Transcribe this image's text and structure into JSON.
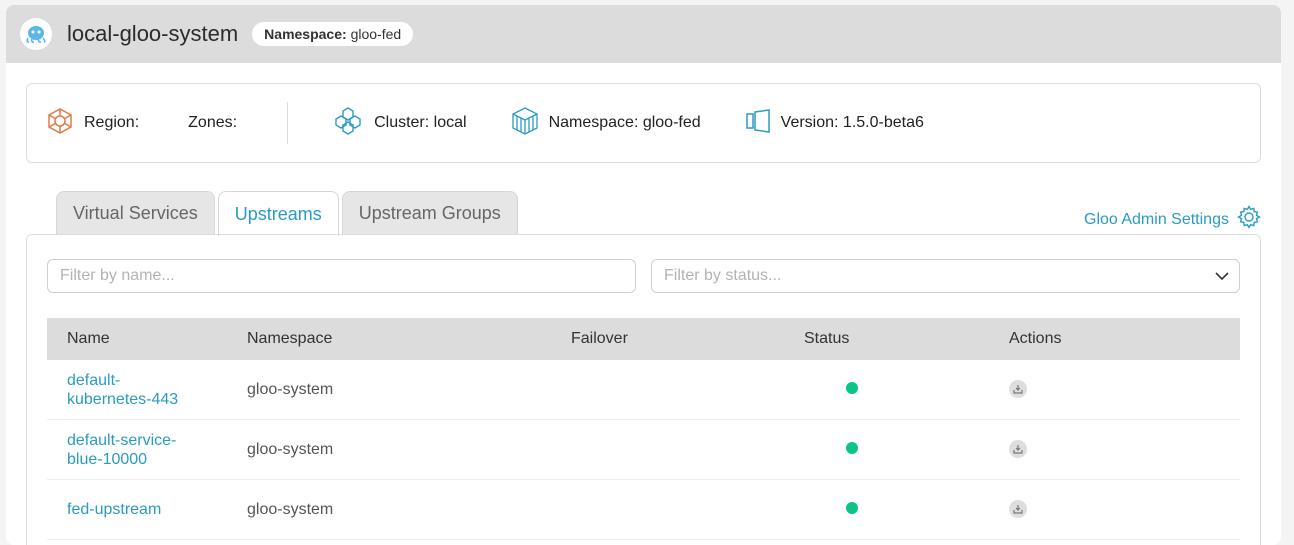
{
  "header": {
    "title": "local-gloo-system",
    "namespace_label": "Namespace:",
    "namespace_value": "gloo-fed"
  },
  "info": {
    "region": "Region:",
    "zones": "Zones:",
    "cluster": "Cluster: local",
    "namespace": "Namespace: gloo-fed",
    "version": "Version: 1.5.0-beta6"
  },
  "tabs": [
    {
      "label": "Virtual Services",
      "active": false
    },
    {
      "label": "Upstreams",
      "active": true
    },
    {
      "label": "Upstream Groups",
      "active": false
    }
  ],
  "settings_link": "Gloo Admin Settings",
  "filters": {
    "name_placeholder": "Filter by name...",
    "status_placeholder": "Filter by status..."
  },
  "table": {
    "columns": [
      "Name",
      "Namespace",
      "Failover",
      "Status",
      "Actions"
    ],
    "rows": [
      {
        "name_line1": "default-",
        "name_line2": "kubernetes-443",
        "namespace": "gloo-system",
        "status": "healthy"
      },
      {
        "name_line1": "default-service-",
        "name_line2": "blue-10000",
        "namespace": "gloo-system",
        "status": "healthy"
      },
      {
        "name_line1": "fed-upstream",
        "name_line2": "",
        "namespace": "gloo-system",
        "status": "healthy"
      }
    ]
  },
  "colors": {
    "accent": "#2a9bc3",
    "status_ok": "#0dc487"
  },
  "icons": {
    "logo": "gloo-octopus-logo",
    "region": "region-icon",
    "cluster": "cluster-icon",
    "namespace": "namespace-cube-icon",
    "version": "version-icon",
    "settings": "gear-icon",
    "dropdown": "chevron-down-icon",
    "action": "download-icon"
  }
}
